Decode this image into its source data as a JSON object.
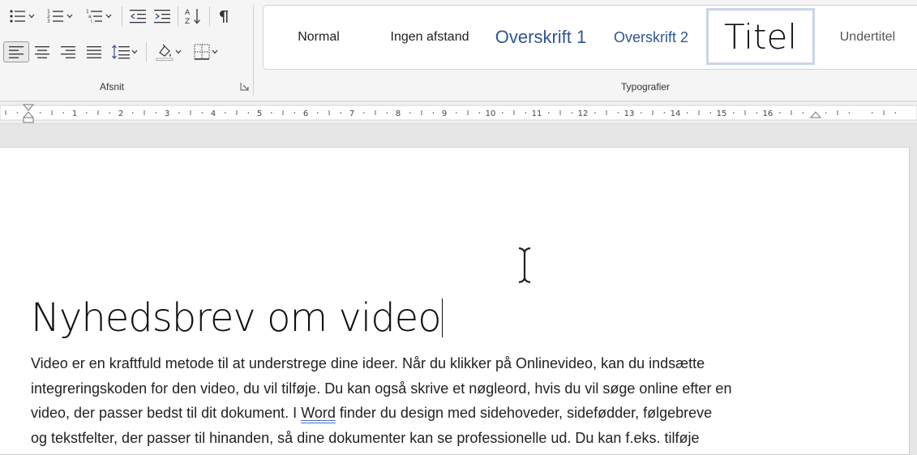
{
  "ribbon": {
    "paragraph": {
      "label": "Afsnit",
      "buttons": [
        "bullets-icon",
        "numbering-icon",
        "multilevel-list-icon",
        "decrease-indent-icon",
        "increase-indent-icon",
        "sort-icon",
        "pilcrow-icon",
        "align-left-icon",
        "align-center-icon",
        "align-right-icon",
        "justify-icon",
        "line-spacing-icon",
        "shading-icon",
        "borders-icon"
      ]
    },
    "styles": {
      "label": "Typografier",
      "items": [
        "Normal",
        "Ingen afstand",
        "Overskrift 1",
        "Overskrift 2",
        "Titel",
        "Undertitel"
      ],
      "selected": "Titel",
      "heading_color": "#2f5597"
    }
  },
  "ruler": {
    "numbers": [
      "1",
      "2",
      "3",
      "4",
      "5",
      "6",
      "7",
      "8",
      "9",
      "10",
      "11",
      "12",
      "13",
      "14",
      "15",
      "16"
    ]
  },
  "document": {
    "title": "Nyhedsbrev om video",
    "lines": [
      {
        "text": "Video er en kraftfuld metode til at understrege dine ideer. Når du klikker på Onlinevideo, kan du indsætte"
      },
      {
        "text": "integreringskoden for den video, du vil tilføje. Du kan også skrive et nøgleord, hvis du vil søge online efter en"
      },
      {
        "pre": "video, der passer bedst til dit dokument. I ",
        "mark": "Word",
        "post": " finder du design med sidehoveder, sidefødder, følgebreve"
      },
      {
        "text": "og tekstfelter, der passer til hinanden, så dine dokumenter kan se professionelle ud. Du kan f.eks. tilføje"
      }
    ]
  }
}
